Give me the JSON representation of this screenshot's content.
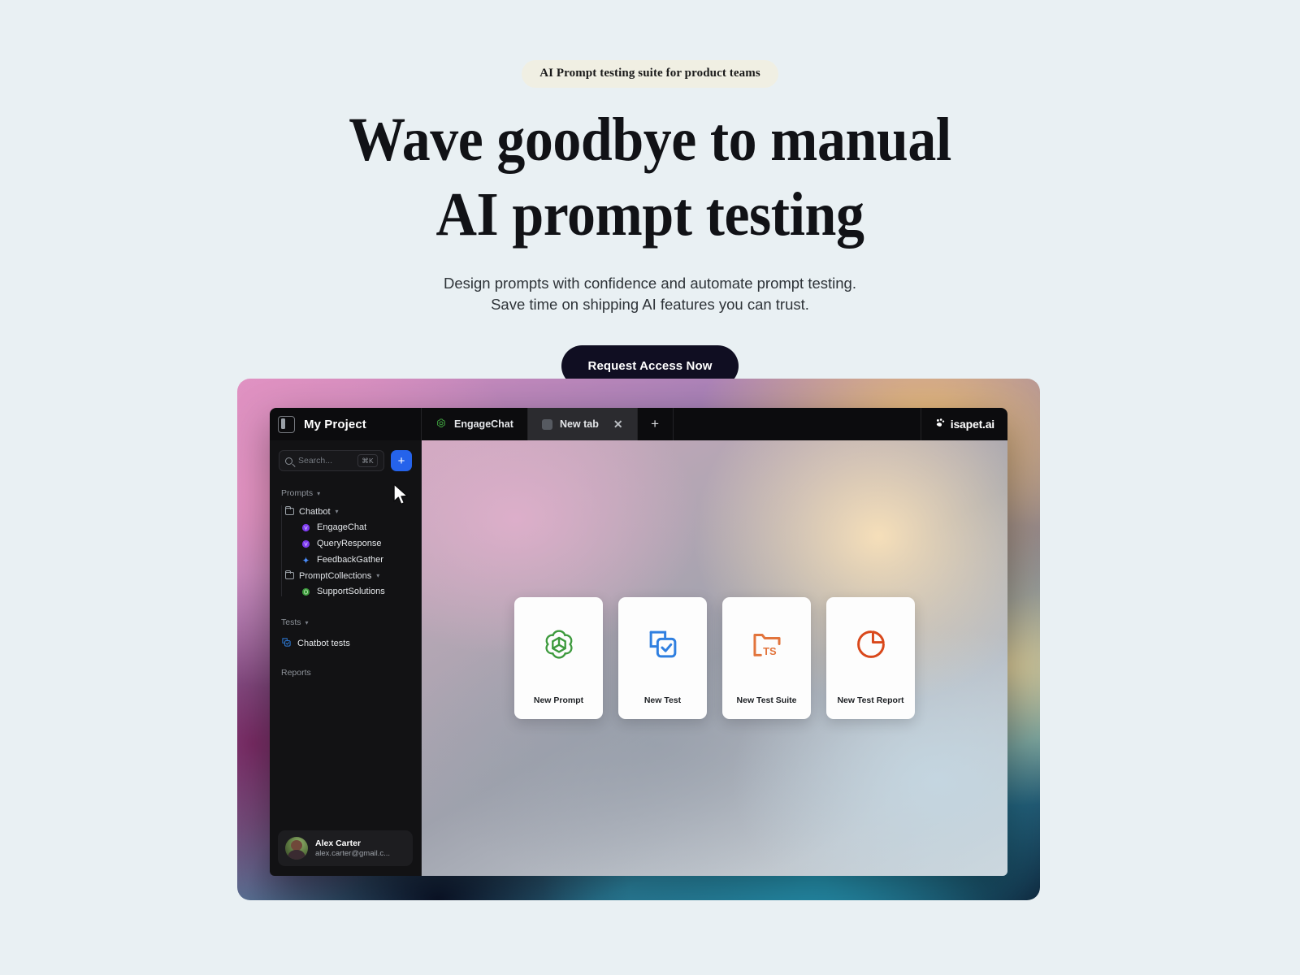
{
  "hero": {
    "badge": "AI Prompt testing suite for product teams",
    "headline_line1": "Wave goodbye to manual",
    "headline_line2": "AI prompt testing",
    "subtitle_line1": "Design prompts with confidence and automate prompt testing.",
    "subtitle_line2": "Save time on shipping AI features you can trust.",
    "cta_label": "Request Access Now",
    "background_color": "#e9f0f3",
    "badge_background": "#f0efe3",
    "cta_background": "#100e22"
  },
  "app": {
    "project_title": "My Project",
    "brand": "isapet.ai",
    "tabs": [
      {
        "label": "EngageChat",
        "icon": "openai-icon",
        "active": false,
        "closable": false
      },
      {
        "label": "New tab",
        "icon": "blank-square-icon",
        "active": true,
        "closable": true,
        "close_label": "✕"
      }
    ],
    "new_tab_button": "+",
    "sidebar": {
      "search_placeholder": "Search...",
      "search_value": "",
      "search_shortcut": "⌘K",
      "add_button": "+",
      "sections": [
        {
          "label": "Prompts",
          "expanded": true
        },
        {
          "label": "Tests",
          "expanded": true
        },
        {
          "label": "Reports",
          "expanded": false
        }
      ],
      "prompts": [
        {
          "folder": "Chatbot",
          "items": [
            {
              "label": "EngageChat",
              "icon": "claude-icon",
              "color": "#7c3aed"
            },
            {
              "label": "QueryResponse",
              "icon": "claude-icon",
              "color": "#7c3aed"
            },
            {
              "label": "FeedbackGather",
              "icon": "gemini-sparkle-icon",
              "color": "#4a8dfd"
            }
          ]
        },
        {
          "folder": "PromptCollections",
          "items": [
            {
              "label": "SupportSolutions",
              "icon": "openai-icon",
              "color": "#3d9a3d"
            }
          ]
        }
      ],
      "tests": [
        {
          "label": "Chatbot tests",
          "icon": "test-stack-icon",
          "color": "#2f7fe0"
        }
      ],
      "user": {
        "name": "Alex Carter",
        "email": "alex.carter@gmail.c...",
        "avatar": "user-photo"
      }
    },
    "cards": [
      {
        "label": "New Prompt",
        "icon": "openai-icon",
        "color": "#3d9a3d"
      },
      {
        "label": "New Test",
        "icon": "test-stack-icon",
        "color": "#2f7fe0"
      },
      {
        "label": "New Test Suite",
        "icon": "folder-ts-icon",
        "color": "#e2743c"
      },
      {
        "label": "New Test Report",
        "icon": "pie-chart-icon",
        "color": "#d9481b"
      }
    ]
  }
}
